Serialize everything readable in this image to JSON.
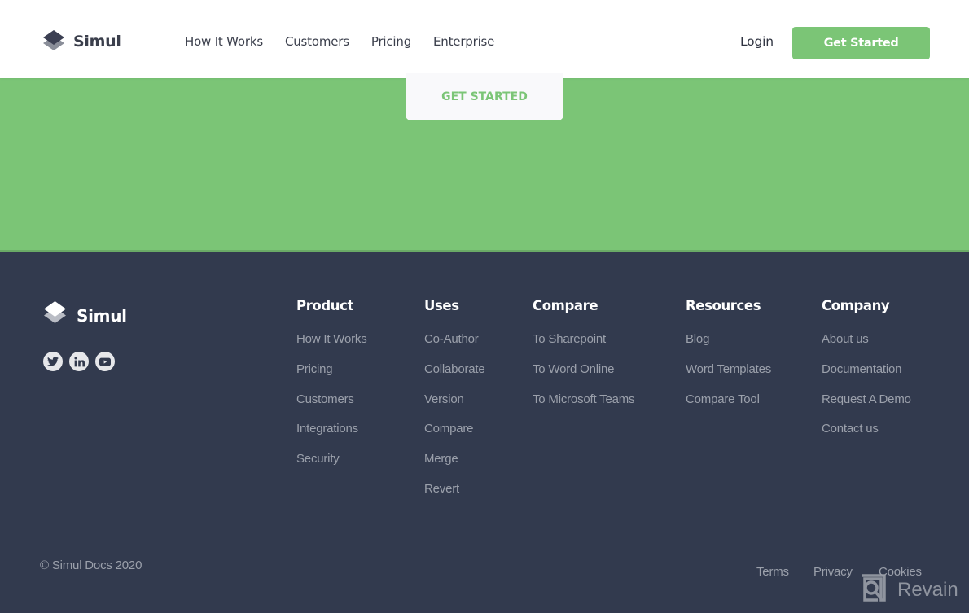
{
  "header": {
    "brand": "Simul",
    "nav": [
      "How It Works",
      "Customers",
      "Pricing",
      "Enterprise"
    ],
    "login_label": "Login",
    "cta_label": "Get Started"
  },
  "band": {
    "button_label": "GET STARTED",
    "color": "#7bc576"
  },
  "footer": {
    "brand": "Simul",
    "social": [
      "twitter-icon",
      "linkedin-icon",
      "youtube-icon"
    ],
    "columns": [
      {
        "title": "Product",
        "links": [
          "How It Works",
          "Pricing",
          "Customers",
          "Integrations",
          "Security"
        ]
      },
      {
        "title": "Uses",
        "links": [
          "Co-Author",
          "Collaborate",
          "Version",
          "Compare",
          "Merge",
          "Revert"
        ]
      },
      {
        "title": "Compare",
        "links": [
          "To Sharepoint",
          "To Word Online",
          "To Microsoft Teams"
        ]
      },
      {
        "title": "Resources",
        "links": [
          "Blog",
          "Word Templates",
          "Compare Tool"
        ]
      },
      {
        "title": "Company",
        "links": [
          "About us",
          "Documentation",
          "Request A Demo",
          "Contact us"
        ]
      }
    ],
    "copyright": "© Simul Docs 2020",
    "legal": [
      "Terms",
      "Privacy",
      "Cookies"
    ],
    "background": "#323a4e"
  },
  "watermark": {
    "text": "Revain"
  }
}
